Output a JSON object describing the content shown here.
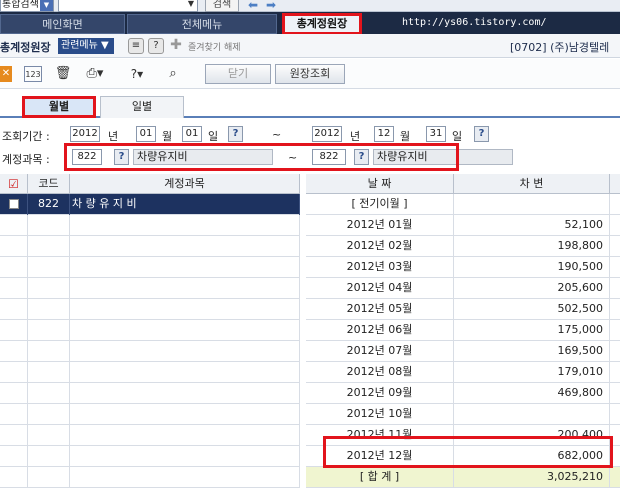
{
  "topbar": {
    "combo_value": "통합검색",
    "search_button": "검색"
  },
  "tabs": [
    {
      "label": "메인화면"
    },
    {
      "label": "전체메뉴"
    },
    {
      "label": "총계정원장"
    }
  ],
  "watermark_url": "http://ys06.tistory.com/",
  "header": {
    "title": "총계정원장",
    "related_menu": "관련메뉴",
    "favorite_label": "즐겨찾기 해제",
    "company": "[0702] (주)남경텔레"
  },
  "toolbar": {
    "close_label": "닫기",
    "view_label": "원장조회"
  },
  "subtabs": [
    {
      "label": "월별"
    },
    {
      "label": "일별"
    }
  ],
  "period": {
    "label": "조회기간 :",
    "from_year": "2012",
    "from_month": "01",
    "from_day": "01",
    "to_year": "2012",
    "to_month": "12",
    "to_day": "31",
    "year_unit": "년",
    "month_unit": "월",
    "day_unit": "일",
    "tilde": "~"
  },
  "account": {
    "label": "계정과목 :",
    "from_code": "822",
    "from_name": "차량유지비",
    "to_code": "822",
    "to_name": "차량유지비",
    "tilde": "~"
  },
  "left_grid": {
    "columns": [
      "코드",
      "계정과목"
    ],
    "rows": [
      {
        "code": "822",
        "name": "차 량 유 지 비"
      }
    ]
  },
  "right_grid": {
    "columns": [
      "날    짜",
      "차    변"
    ],
    "rows": [
      {
        "date": "[ 전기이월 ]",
        "debit": ""
      },
      {
        "date": "2012년 01월",
        "debit": "52,100"
      },
      {
        "date": "2012년 02월",
        "debit": "198,800"
      },
      {
        "date": "2012년 03월",
        "debit": "190,500"
      },
      {
        "date": "2012년 04월",
        "debit": "205,600"
      },
      {
        "date": "2012년 05월",
        "debit": "502,500"
      },
      {
        "date": "2012년 06월",
        "debit": "175,000"
      },
      {
        "date": "2012년 07월",
        "debit": "169,500"
      },
      {
        "date": "2012년 08월",
        "debit": "179,010"
      },
      {
        "date": "2012년 09월",
        "debit": "469,800"
      },
      {
        "date": "2012년 10월",
        "debit": ""
      },
      {
        "date": "2012년 11월",
        "debit": "200,400"
      },
      {
        "date": "2012년 12월",
        "debit": "682,000"
      },
      {
        "date": "[ 합    계 ]",
        "debit": "3,025,210"
      }
    ]
  },
  "colors": {
    "accent_red": "#e2141c",
    "selected_row": "#1d3260",
    "dark_tabbar": "#1c2a44"
  }
}
